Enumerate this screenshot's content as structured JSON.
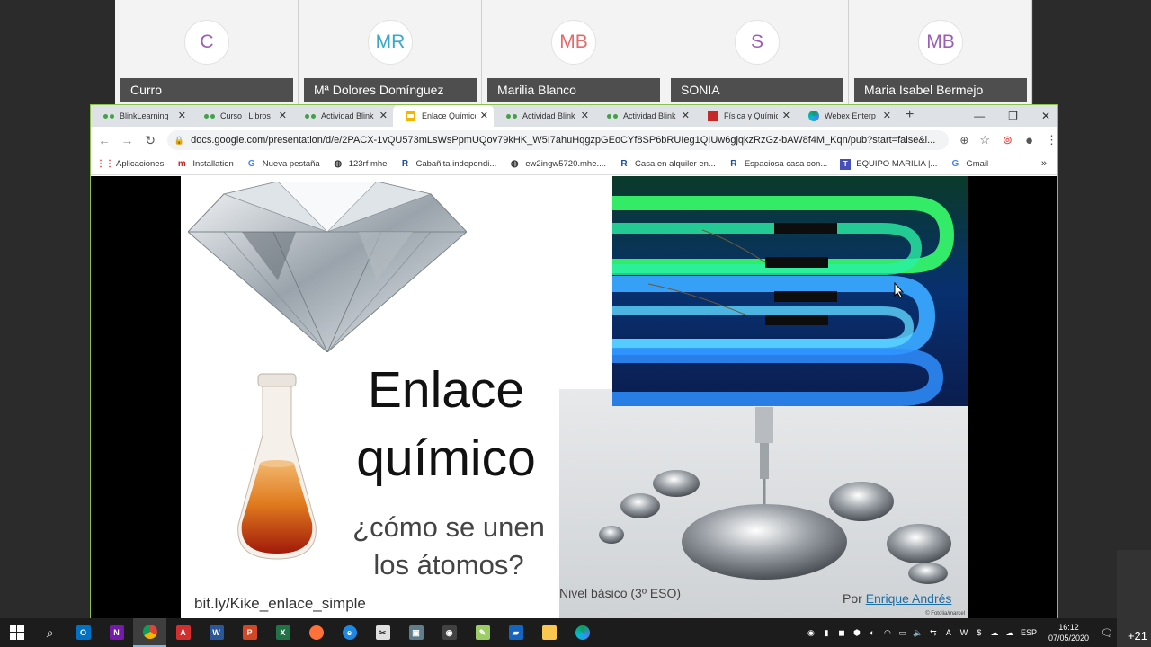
{
  "participants": [
    {
      "initials": "C",
      "name": "Curro",
      "color": "#9c5fb5"
    },
    {
      "initials": "MR",
      "name": "Mª Dolores Domínguez",
      "color": "#3aa9c9"
    },
    {
      "initials": "MB",
      "name": "Marilia Blanco",
      "color": "#e46a6a"
    },
    {
      "initials": "S",
      "name": "SONIA",
      "color": "#9c5fb5"
    },
    {
      "initials": "MB",
      "name": "Maria Isabel Bermejo",
      "color": "#9c5fb5"
    }
  ],
  "tabs": [
    {
      "label": "BlinkLearning",
      "icon": "blinklearning-icon"
    },
    {
      "label": "Curso | Libros",
      "icon": "blinklearning-icon"
    },
    {
      "label": "Actividad Blink",
      "icon": "blinklearning-icon"
    },
    {
      "label": "Enlace Químico",
      "icon": "google-slides-icon",
      "active": true
    },
    {
      "label": "Actividad Blink",
      "icon": "blinklearning-icon"
    },
    {
      "label": "Actividad Blink",
      "icon": "blinklearning-icon"
    },
    {
      "label": "Física y Química",
      "icon": "book-icon"
    },
    {
      "label": "Webex Enterp",
      "icon": "webex-icon"
    }
  ],
  "address": {
    "url": "docs.google.com/presentation/d/e/2PACX-1vQU573mLsWsPpmUQov79kHK_W5I7ahuHqgzpGEoCYf8SP6bRUIeg1QIUw6gjqkzRzGz-bAW8f4M_Kqn/pub?start=false&l..."
  },
  "bookmarks": [
    {
      "label": "Aplicaciones",
      "icon": "apps-grid-icon"
    },
    {
      "label": "Installation",
      "icon": "mcgraw-hill-icon"
    },
    {
      "label": "Nueva pestaña",
      "icon": "google-icon"
    },
    {
      "label": "123rf mhe",
      "icon": "globe-icon"
    },
    {
      "label": "Cabañita independi...",
      "icon": "r-icon"
    },
    {
      "label": "ew2ingw5720.mhe....",
      "icon": "globe-icon"
    },
    {
      "label": "Casa en alquiler en...",
      "icon": "r-icon"
    },
    {
      "label": "Espaciosa casa con...",
      "icon": "r-icon"
    },
    {
      "label": "EQUIPO MARILIA |...",
      "icon": "teams-icon"
    },
    {
      "label": "Gmail",
      "icon": "google-icon"
    }
  ],
  "slide": {
    "title_line1": "Enlace",
    "title_line2": "químico",
    "subtitle_line1": "¿cómo se unen",
    "subtitle_line2": "los átomos?",
    "link": "bit.ly/Kike_enlace_simple",
    "level": "Nivel básico (3º ESO)",
    "author_prefix": "Por",
    "author_name": "Enrique Andrés",
    "photo_credit": "© Fotolia/marcel"
  },
  "taskbar": {
    "language": "ESP",
    "time": "16:12",
    "date": "07/05/2020",
    "notifications": "1"
  },
  "overflow_count": "+21"
}
